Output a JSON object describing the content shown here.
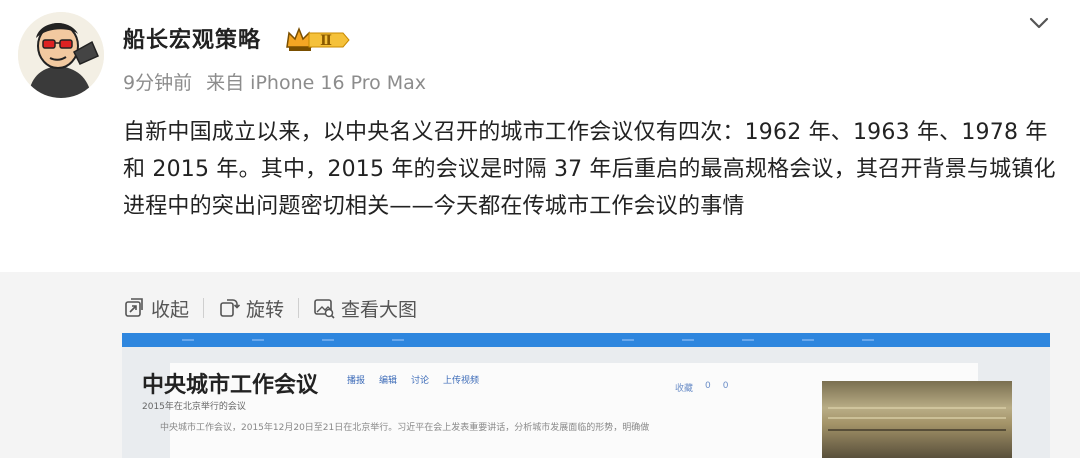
{
  "post": {
    "username": "船长宏观策略",
    "vip_badge": "Ⅱ",
    "time": "9分钟前",
    "source": "来自 iPhone 16 Pro Max",
    "content": "自新中国成立以来，以中央名义召开的城市工作会议仅有四次：1962 年、1963 年、1978 年和 2015 年。其中，2015 年的会议是时隔 37 年后重启的最高规格会议，其召开背景与城镇化进程中的突出问题密切相关——今天都在传城市工作会议的事情"
  },
  "toolbar": {
    "collapse_label": "收起",
    "rotate_label": "旋转",
    "view_large_label": "查看大图"
  },
  "image": {
    "title": "中央城市工作会议",
    "subtitle": "2015年在北京举行的会议",
    "actions": [
      "播报",
      "编辑",
      "讨论",
      "上传视频"
    ],
    "stats": [
      "收藏",
      "0",
      "0"
    ],
    "body_line": "中央城市工作会议，2015年12月20日至21日在北京举行。习近平在会上发表重要讲话，分析城市发展面临的形势，明确做"
  },
  "colors": {
    "accent": "#2e86de",
    "badge_gold": "#f5a623",
    "meta_gray": "#8c8c8c"
  },
  "icons": {
    "more": "chevron-down-icon",
    "collapse": "collapse-icon",
    "rotate": "rotate-icon",
    "view_large": "image-view-icon"
  }
}
